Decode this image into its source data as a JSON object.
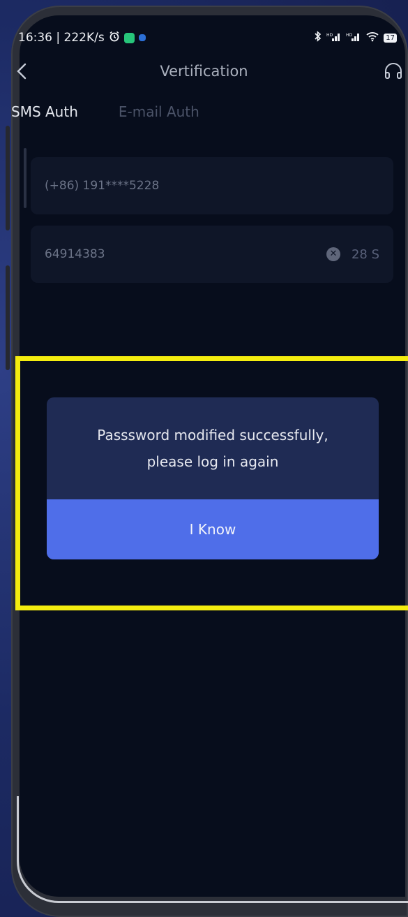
{
  "status_bar": {
    "time_speed": "16:36 | 222K/s",
    "battery": "17"
  },
  "nav": {
    "title": "Vertification"
  },
  "tabs": [
    {
      "label": "SMS Auth"
    },
    {
      "label": "E-mail Auth"
    }
  ],
  "phone_field": {
    "value": "(+86) 191****5228"
  },
  "code_field": {
    "value": "64914383",
    "countdown": "28 S"
  },
  "dialog": {
    "message_line1": "Passsword modified successfully,",
    "message_line2": "please log in again",
    "button_label": "I Know"
  },
  "colors": {
    "highlight": "#f4ec0f",
    "accent": "#4f6ee9",
    "dialog_bg": "#1f2b54",
    "screen_bg": "#070d1c"
  }
}
